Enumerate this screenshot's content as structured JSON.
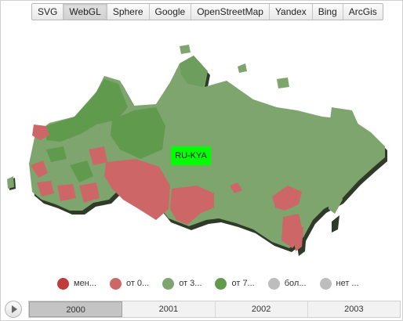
{
  "tabs": [
    {
      "label": "SVG",
      "active": false
    },
    {
      "label": "WebGL",
      "active": true
    },
    {
      "label": "Sphere",
      "active": false
    },
    {
      "label": "Google",
      "active": false
    },
    {
      "label": "OpenStreetMap",
      "active": false
    },
    {
      "label": "Yandex",
      "active": false
    },
    {
      "label": "Bing",
      "active": false
    },
    {
      "label": "ArcGis",
      "active": false
    }
  ],
  "map": {
    "selected_region_label": "RU-KYA",
    "colors": {
      "dark_red": "#c23b3b",
      "light_red": "#cd6767",
      "light_green": "#7ea56e",
      "mid_green": "#5f9a4d",
      "gray": "#bdbdbd",
      "extrusion": "#2f3a28",
      "highlight": "#00ff00"
    }
  },
  "legend": [
    {
      "label": "мен...",
      "color": "#c23b3b"
    },
    {
      "label": "от 0...",
      "color": "#cd6767"
    },
    {
      "label": "от 3...",
      "color": "#7ea56e"
    },
    {
      "label": "от 7...",
      "color": "#5f9a4d"
    },
    {
      "label": "бол...",
      "color": "#bdbdbd"
    },
    {
      "label": "нет ...",
      "color": "#bdbdbd"
    }
  ],
  "timeline": {
    "years": [
      "2000",
      "2001",
      "2002",
      "2003"
    ],
    "active_year": "2000"
  }
}
